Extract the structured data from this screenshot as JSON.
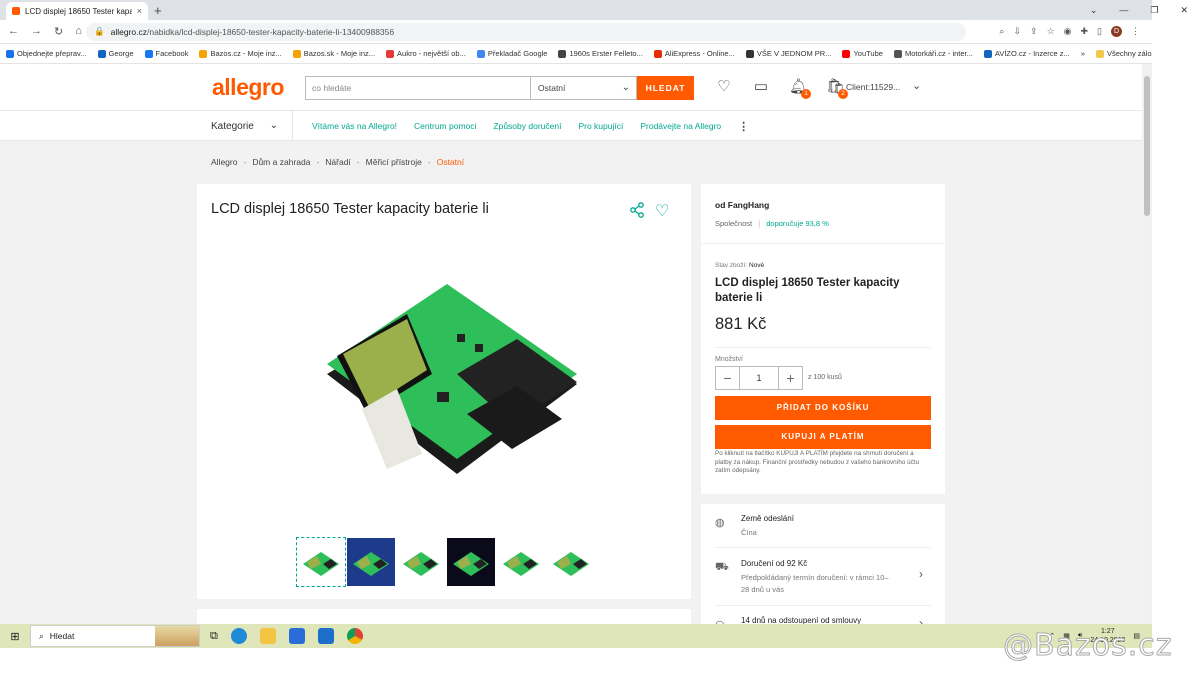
{
  "browser": {
    "tab_title": "LCD displej 18650 Tester kapaci",
    "tab_close": "×",
    "new_tab": "+",
    "url_host": "allegro.cz",
    "url_path": "/nabidka/lcd-displej-18650-tester-kapacity-baterie-li-13400988356",
    "profile_initial": "D",
    "bookmarks": [
      {
        "label": "Objednejte přeprav...",
        "color": "#1a73e8"
      },
      {
        "label": "George",
        "color": "#1565c0"
      },
      {
        "label": "Facebook",
        "color": "#1877f2"
      },
      {
        "label": "Bazos.cz - Moje inz...",
        "color": "#f4a300"
      },
      {
        "label": "Bazos.sk - Moje inz...",
        "color": "#f4a300"
      },
      {
        "label": "Aukro - největší ob...",
        "color": "#e53935"
      },
      {
        "label": "Překladač Google",
        "color": "#4285f4"
      },
      {
        "label": "1960s Erster Felleto...",
        "color": "#444444"
      },
      {
        "label": "AliExpress - Online...",
        "color": "#e62e04"
      },
      {
        "label": "VŠE V JEDNOM PR...",
        "color": "#333333"
      },
      {
        "label": "YouTube",
        "color": "#ff0000"
      },
      {
        "label": "Motorkáři.cz - inter...",
        "color": "#555555"
      },
      {
        "label": "AVÍZO.cz - Inzerce z...",
        "color": "#1565c0"
      }
    ],
    "bookmarks_more": "»",
    "all_bookmarks": "Všechny záložky"
  },
  "header": {
    "logo": "allegro",
    "search_placeholder": "co hledáte",
    "category": "Ostatní",
    "search_button": "HLEDAT",
    "notifications_badge": "1",
    "cart_badge": "2",
    "client": "Client:11529..."
  },
  "subnav": {
    "categories": "Kategorie",
    "links": [
      "Vítáme vás na Allegro!",
      "Centrum pomoci",
      "Způsoby doručení",
      "Pro kupující",
      "Prodávejte na Allegro"
    ]
  },
  "breadcrumb": [
    "Allegro",
    "Dům a zahrada",
    "Nářadí",
    "Měřicí přístroje",
    "Ostatní"
  ],
  "breadcrumb_sep": "-",
  "product": {
    "title": "LCD displej 18650 Tester kapacity baterie li"
  },
  "seller": {
    "name": "od FangHang",
    "type": "Společnost",
    "divider": "|",
    "recommend": "doporučuje 93,8 %"
  },
  "offer": {
    "condition_label": "Stav zboží:",
    "condition_value": "Nové",
    "title": "LCD displej 18650 Tester kapacity baterie li",
    "price": "881 Kč",
    "qty_label": "Množství",
    "qty_value": "1",
    "qty_minus": "−",
    "qty_plus": "+",
    "qty_of": "z 100 kusů",
    "add_to_cart": "PŘIDAT DO KOŠÍKU",
    "buy_now": "KUPUJI A PLATÍM",
    "note": "Po kliknutí na tlačítko KUPUJI A PLATÍM přejdete na shrnutí doručení a platby za nákup. Finanční prostředky nebudou z vašeho bankovního účtu zatím odepsány."
  },
  "shipping": {
    "country_label": "Země odeslání",
    "country_value": "Čína",
    "delivery_label": "Doručení od 92 Kč",
    "delivery_detail": "Předpokládaný termín doručení: v rámci 10–28 dnů u vás",
    "returns_label": "14 dnů na odstoupení od smlouvy"
  },
  "taskbar": {
    "search": "Hledat",
    "time": "1:27",
    "date": "24.10.2023"
  },
  "watermark": "@Bazos.cz",
  "colors": {
    "brand": "#ff5a00",
    "accent": "#00a790"
  }
}
